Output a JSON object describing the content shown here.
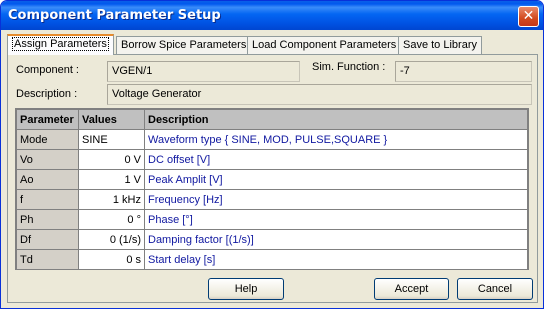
{
  "window": {
    "title": "Component Parameter Setup"
  },
  "tabs": [
    {
      "label": "Assign Parameters",
      "active": true
    },
    {
      "label": "Borrow Spice Parameters",
      "active": false
    },
    {
      "label": "Load Component Parameters",
      "active": false
    },
    {
      "label": "Save to Library",
      "active": false
    }
  ],
  "form": {
    "component_label": "Component :",
    "component_value": "VGEN/1",
    "sim_function_label": "Sim. Function :",
    "sim_function_value": "-7",
    "description_label": "Description :",
    "description_value": "Voltage Generator"
  },
  "grid": {
    "headers": [
      "Parameter",
      "Values",
      "Description"
    ],
    "rows": [
      {
        "param": "Mode",
        "value": "SINE",
        "desc": "Waveform type { SINE, MOD, PULSE,SQUARE }"
      },
      {
        "param": "Vo",
        "value": "0 V",
        "desc": "DC offset [V]"
      },
      {
        "param": "Ao",
        "value": "1 V",
        "desc": "Peak Amplit [V]"
      },
      {
        "param": "f",
        "value": "1 kHz",
        "desc": "Frequency [Hz]"
      },
      {
        "param": "Ph",
        "value": "0 °",
        "desc": "Phase [°]"
      },
      {
        "param": "Df",
        "value": "0 (1/s)",
        "desc": "Damping factor [(1/s)]"
      },
      {
        "param": "Td",
        "value": "0 s",
        "desc": "Start delay [s]"
      }
    ]
  },
  "buttons": {
    "help": "Help",
    "accept": "Accept",
    "cancel": "Cancel"
  },
  "icons": {
    "close": "close-icon"
  }
}
